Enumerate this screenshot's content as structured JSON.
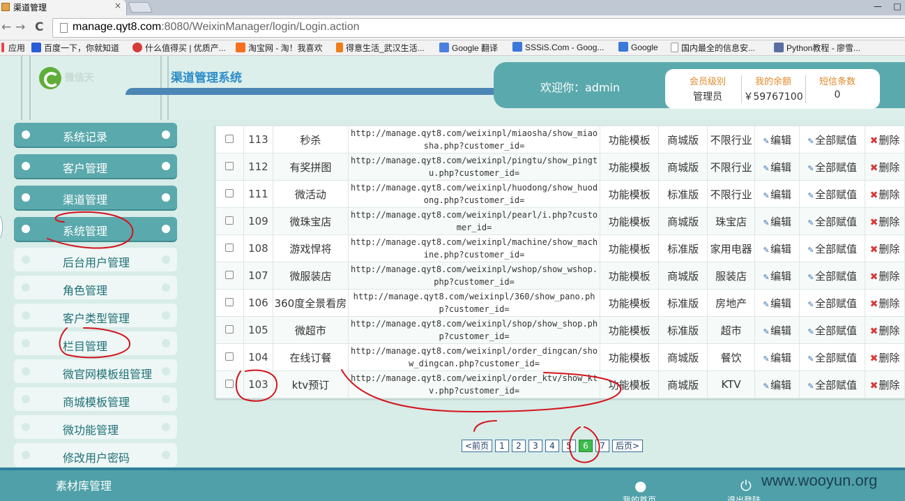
{
  "browser": {
    "tab_title": "渠道管理",
    "tab_close": "×",
    "url_host": "manage.qyt8.com",
    "url_rest": ":8080/WeixinManager/login/Login.action",
    "nav_back": "←",
    "nav_forward": "→",
    "nav_reload": "C",
    "win_min": "—",
    "win_max": "□",
    "bookmarks": [
      {
        "label": "应用",
        "icon": "apps-icon",
        "color": "#e44"
      },
      {
        "label": "百度一下，你就知道",
        "icon": "baidu-icon",
        "color": "#2a5bd8"
      },
      {
        "label": "什么值得买 | 优质产...",
        "icon": "smzdm-icon",
        "color": "#d63b3b"
      },
      {
        "label": "淘宝网 - 淘！我喜欢",
        "icon": "taobao-icon",
        "color": "#f5701f"
      },
      {
        "label": "得意生活_武汉生活...",
        "icon": "deyi-icon",
        "color": "#ef7d1a"
      },
      {
        "label": "Google 翻译",
        "icon": "translate-icon",
        "color": "#4a7fe0"
      },
      {
        "label": "SSSiS.Com - Goog...",
        "icon": "sssis-icon",
        "color": "#3b78d8"
      },
      {
        "label": "Google",
        "icon": "google-icon",
        "color": "#3b78d8"
      },
      {
        "label": "国内最全的信息安...",
        "icon": "page-icon",
        "color": "#bbb"
      },
      {
        "label": "Python教程 - 廖雪...",
        "icon": "python-icon",
        "color": "#5a6ea0"
      }
    ]
  },
  "header": {
    "logo_text": "微信天",
    "system_title": "渠道管理系统",
    "welcome": "欢迎你：admin",
    "stats": [
      {
        "label": "会员级别",
        "value": "管理员"
      },
      {
        "label": "我的余额",
        "value": "￥59767100"
      },
      {
        "label": "短信条数",
        "value": "0"
      }
    ]
  },
  "sidebar": {
    "main_items": [
      {
        "label": "系统记录"
      },
      {
        "label": "客户管理"
      },
      {
        "label": "渠道管理"
      },
      {
        "label": "系统管理"
      }
    ],
    "sub_items": [
      {
        "label": "后台用户管理"
      },
      {
        "label": "角色管理"
      },
      {
        "label": "客户类型管理"
      },
      {
        "label": "栏目管理"
      },
      {
        "label": "微官网模板组管理"
      },
      {
        "label": "商城模板管理"
      },
      {
        "label": "微功能管理"
      },
      {
        "label": "修改用户密码"
      }
    ]
  },
  "table": {
    "action_edit": "编辑",
    "action_assign": "全部赋值",
    "action_delete": "删除",
    "rows": [
      {
        "id": "113",
        "name": "秒杀",
        "url": "http://manage.qyt8.com/weixinpl/miaosha/show_miaosha.php?customer_id=",
        "type": "功能模板",
        "edition": "商城版",
        "industry": "不限行业"
      },
      {
        "id": "112",
        "name": "有奖拼图",
        "url": "http://manage.qyt8.com/weixinpl/pingtu/show_pingtu.php?customer_id=",
        "type": "功能模板",
        "edition": "商城版",
        "industry": "不限行业"
      },
      {
        "id": "111",
        "name": "微活动",
        "url": "http://manage.qyt8.com/weixinpl/huodong/show_huodong.php?customer_id=",
        "type": "功能模板",
        "edition": "标准版",
        "industry": "不限行业"
      },
      {
        "id": "109",
        "name": "微珠宝店",
        "url": "http://manage.qyt8.com/weixinpl/pearl/i.php?customer_id=",
        "type": "功能模板",
        "edition": "商城版",
        "industry": "珠宝店"
      },
      {
        "id": "108",
        "name": "游戏悍将",
        "url": "http://manage.qyt8.com/weixinpl/machine/show_machine.php?customer_id=",
        "type": "功能模板",
        "edition": "标准版",
        "industry": "家用电器"
      },
      {
        "id": "107",
        "name": "微服装店",
        "url": "http://manage.qyt8.com/weixinpl/wshop/show_wshop.php?customer_id=",
        "type": "功能模板",
        "edition": "商城版",
        "industry": "服装店"
      },
      {
        "id": "106",
        "name": "360度全景看房",
        "url": "http://manage.qyt8.com/weixinpl/360/show_pano.php?customer_id=",
        "type": "功能模板",
        "edition": "标准版",
        "industry": "房地产"
      },
      {
        "id": "105",
        "name": "微超市",
        "url": "http://manage.qyt8.com/weixinpl/shop/show_shop.php?customer_id=",
        "type": "功能模板",
        "edition": "标准版",
        "industry": "超市"
      },
      {
        "id": "104",
        "name": "在线订餐",
        "url": "http://manage.qyt8.com/weixinpl/order_dingcan/show_dingcan.php?customer_id=",
        "type": "功能模板",
        "edition": "商城版",
        "industry": "餐饮"
      },
      {
        "id": "103",
        "name": "ktv预订",
        "url": "http://manage.qyt8.com/weixinpl/order_ktv/show_ktv.php?customer_id=",
        "type": "功能模板",
        "edition": "商城版",
        "industry": "KTV"
      }
    ]
  },
  "pagination": {
    "prev": "<前页",
    "next": "后页>",
    "pages": [
      "1",
      "2",
      "3",
      "4",
      "5",
      "6",
      "7"
    ],
    "current": "6"
  },
  "footer": {
    "library": "素材库管理",
    "home": "我的首页",
    "logout": "退出登陆",
    "watermark": "www.wooyun.org"
  }
}
